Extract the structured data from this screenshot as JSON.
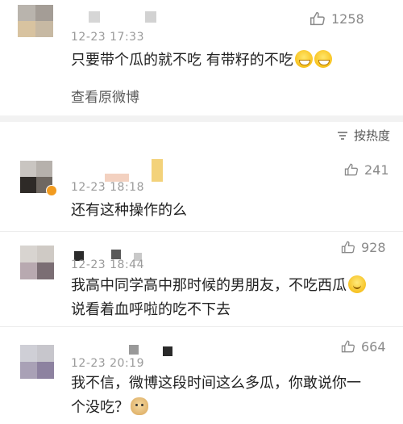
{
  "top_post": {
    "time": "12-23 17:33",
    "like_count": "1258",
    "text": "只要带个瓜的就不吃  有带籽的不吃",
    "view_original": "查看原微博"
  },
  "sort": {
    "label": "按热度",
    "icon": "sort-icon"
  },
  "comments": [
    {
      "time": "12-23 18:18",
      "like_count": "241",
      "lines": [
        "还有这种操作的么"
      ]
    },
    {
      "time": "12-23 18:44",
      "like_count": "928",
      "lines": [
        "我高中同学高中那时候的男朋友，不吃西瓜",
        "说看着血呼啦的吃不下去"
      ]
    },
    {
      "time": "12-23 20:19",
      "like_count": "664",
      "lines": [
        "我不信，微博这段时间这么多瓜，你敢说你一",
        "个没吃？"
      ]
    }
  ],
  "colors": {
    "gap": "#f2f2f2",
    "muted": "#9a9a9a",
    "text": "#222222"
  }
}
